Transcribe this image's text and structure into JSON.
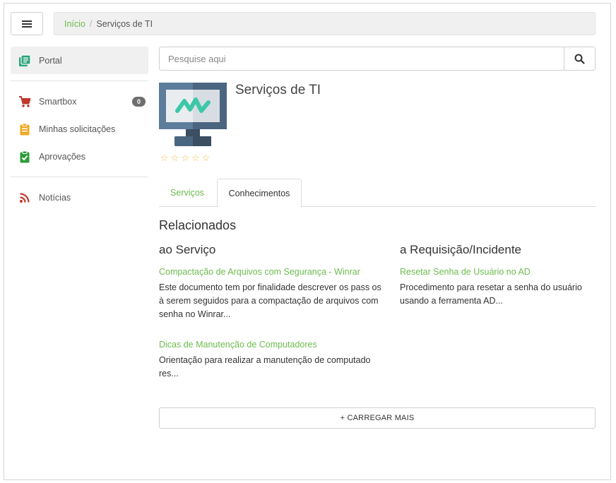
{
  "breadcrumb": {
    "home": "Início",
    "separator": "/",
    "current": "Serviços de TI"
  },
  "sidebar": {
    "items": [
      {
        "label": "Portal",
        "icon": "portal-book-icon",
        "color": "#2aa37a"
      },
      {
        "label": "Smartbox",
        "icon": "cart-icon",
        "color": "#c0392b",
        "badge": "0"
      },
      {
        "label": "Minhas solicitações",
        "icon": "clipboard-list-icon",
        "color": "#f0a81f"
      },
      {
        "label": "Aprovações",
        "icon": "clipboard-check-icon",
        "color": "#2e9b3a"
      },
      {
        "label": "Notícias",
        "icon": "rss-icon",
        "color": "#c0392b"
      }
    ]
  },
  "search": {
    "placeholder": "Pesquise aqui",
    "value": "",
    "icon": "search-icon"
  },
  "service": {
    "title": "Serviços de TI",
    "image": "monitor-icon",
    "rating": 0,
    "max_rating": 5
  },
  "tabs": [
    {
      "label": "Serviços",
      "active": false
    },
    {
      "label": "Conhecimentos",
      "active": true
    }
  ],
  "related": {
    "title": "Relacionados",
    "service_column": {
      "heading": "ao Serviço",
      "articles": [
        {
          "title": "Compactação de Arquivos com Segurança - Winrar",
          "summary": "Este documento tem por finalidade descrever os pass os à serem seguidos para a compactação de arquivos com senha no Winrar..."
        },
        {
          "title": "Dicas de Manutenção de Computadores",
          "summary": "Orientação para realizar a manutenção de computado res..."
        }
      ]
    },
    "request_column": {
      "heading": "a Requisição/Incidente",
      "articles": [
        {
          "title": "Resetar Senha de Usuário no AD",
          "summary": "Procedimento para resetar a senha do usuário usando a ferramenta AD..."
        }
      ]
    }
  },
  "load_more": "+ CARREGAR MAIS",
  "colors": {
    "accent": "#6dbb4f",
    "star": "#f0c24b"
  }
}
